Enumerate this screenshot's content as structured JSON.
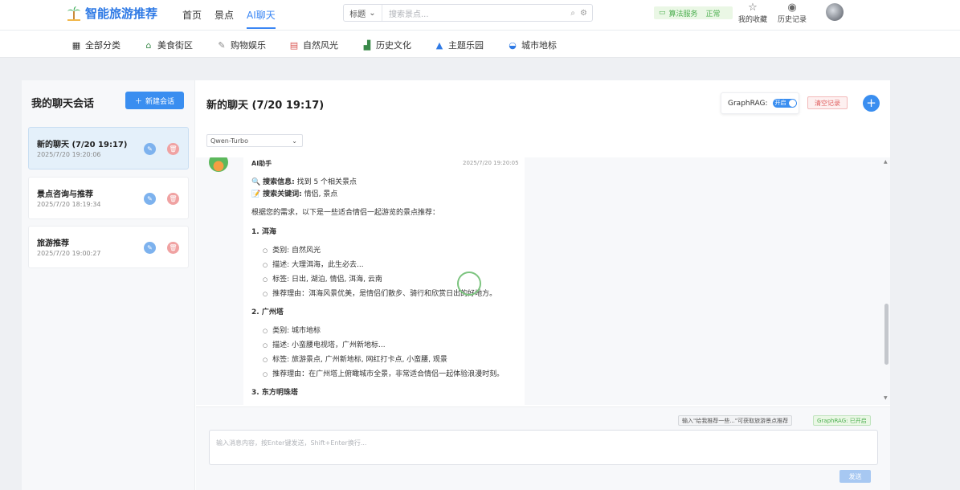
{
  "app": {
    "name": "智能旅游推荐"
  },
  "nav": {
    "items": [
      {
        "label": "首页"
      },
      {
        "label": "景点"
      },
      {
        "label": "AI聊天"
      }
    ]
  },
  "search": {
    "select_label": "标题",
    "placeholder": "搜索景点..."
  },
  "service_status": {
    "label": "算法服务",
    "value": "正常"
  },
  "toolbar": {
    "favorites_label": "我的收藏",
    "history_label": "历史记录"
  },
  "categories": [
    {
      "label": "全部分类",
      "icon": "grid-icon"
    },
    {
      "label": "美食街区",
      "icon": "food-icon"
    },
    {
      "label": "购物娱乐",
      "icon": "shopping-icon"
    },
    {
      "label": "自然风光",
      "icon": "nature-icon"
    },
    {
      "label": "历史文化",
      "icon": "history-icon"
    },
    {
      "label": "主题乐园",
      "icon": "park-icon"
    },
    {
      "label": "城市地标",
      "icon": "landmark-icon"
    }
  ],
  "sidebar": {
    "title": "我的聊天会话",
    "new_button": "新建会话",
    "sessions": [
      {
        "title": "新的聊天 (7/20 19:17)",
        "time": "2025/7/20 19:20:06"
      },
      {
        "title": "景点咨询与推荐",
        "time": "2025/7/20 18:19:34"
      },
      {
        "title": "旅游推荐",
        "time": "2025/7/20 19:00:27"
      }
    ]
  },
  "chat": {
    "title": "新的聊天 (7/20 19:17)",
    "graphrag_label": "GraphRAG:",
    "graphrag_toggle": "开启",
    "clear_button": "清空记录",
    "model": "Qwen-Turbo",
    "message": {
      "sender": "AI助手",
      "time": "2025/7/20 19:20:05",
      "search_info_key": "搜索信息:",
      "search_info_val": "找到 5 个相关景点",
      "keywords_key": "搜索关键词:",
      "keywords_val": "情侣, 景点",
      "intro": "根据您的需求，以下是一些适合情侣一起游览的景点推荐：",
      "items": [
        {
          "heading": "1. 洱海",
          "bullets": [
            "类别: 自然风光",
            "描述: 大理洱海，此生必去...",
            "标签: 日出, 湖泊, 情侣, 洱海, 云南",
            "推荐理由：洱海风景优美，是情侣们散步、骑行和欣赏日出的好地方。"
          ]
        },
        {
          "heading": "2. 广州塔",
          "bullets": [
            "类别: 城市地标",
            "描述: 小蛮腰电视塔，广州新地标...",
            "标签: 旅游景点, 广州新地标, 网红打卡点, 小蛮腰, 观景",
            "推荐理由：在广州塔上俯瞰城市全景，非常适合情侣一起体验浪漫时刻。"
          ]
        },
        {
          "heading": "3. 东方明珠塔"
        }
      ]
    },
    "hint": "输入\"给我推荐一些...\"可获取旅游景点推荐",
    "graphrag_status": "GraphRAG: 已开启",
    "input_placeholder": "输入消息内容，按Enter键发送，Shift+Enter换行...",
    "send_button": "发送"
  },
  "colors": {
    "accent": "#3a8ef0",
    "danger": "#e05d5d",
    "success": "#4caf50"
  }
}
